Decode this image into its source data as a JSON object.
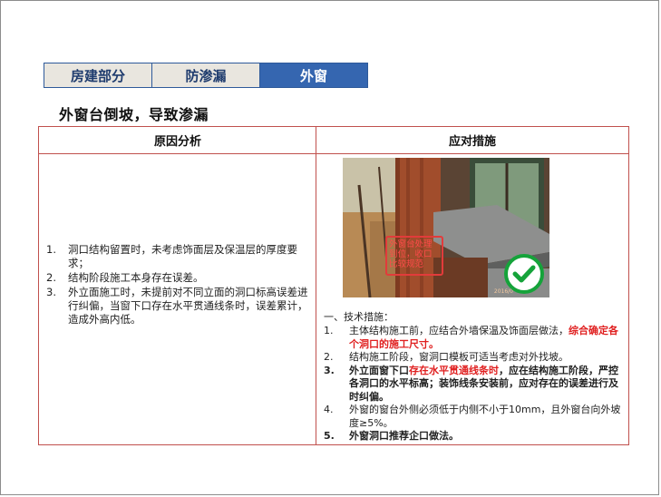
{
  "tabs": [
    {
      "label": "房建部分",
      "active": false
    },
    {
      "label": "防渗漏",
      "active": false
    },
    {
      "label": "外窗",
      "active": true
    }
  ],
  "title": "外窗台倒坡，导致渗漏",
  "table": {
    "header_left": "原因分析",
    "header_right": "应对措施"
  },
  "causes": [
    {
      "num": "1.",
      "text": "洞口结构留置时，未考虑饰面层及保温层的厚度要求；"
    },
    {
      "num": "2.",
      "text": "结构阶段施工本身存在误差。"
    },
    {
      "num": "3.",
      "text": "外立面施工时，未提前对不同立面的洞口标高误差进行纠偏，当窗下口存在水平贯通线条时，误差累计，造成外高内低。"
    }
  ],
  "photo": {
    "callout": "外窗台处理到位，收口比较规范",
    "stamp": "2016/0",
    "check_icon": "check-circle-icon",
    "check_color": "#15a33a"
  },
  "measures": {
    "heading": "一、技术措施：",
    "items": [
      {
        "num": "1.",
        "a": "主体结构施工前，应结合外墙保温及饰面层做法，",
        "b": "综合确定各个洞口的施工尺寸。"
      },
      {
        "num": "2.",
        "a": "结构施工阶段，窗洞口模板可适当考虑对外找坡。"
      },
      {
        "num": "3.",
        "a": "外立面窗下口",
        "b": "存在水平贯通线条时",
        "c": "，应在结构施工阶段，严控各洞口的水平标高；装饰线条安装前，应对存在的误差进行及时纠偏。"
      },
      {
        "num": "4.",
        "a": "外窗的窗台外侧必须低于内侧不小于10mm，且外窗台向外坡度≥5%。"
      },
      {
        "num": "5.",
        "a": "外窗洞口推荐企口做法。"
      }
    ]
  },
  "colors": {
    "accent_blue": "#3566b0",
    "table_border": "#c0504d",
    "highlight_red": "#e02020"
  }
}
